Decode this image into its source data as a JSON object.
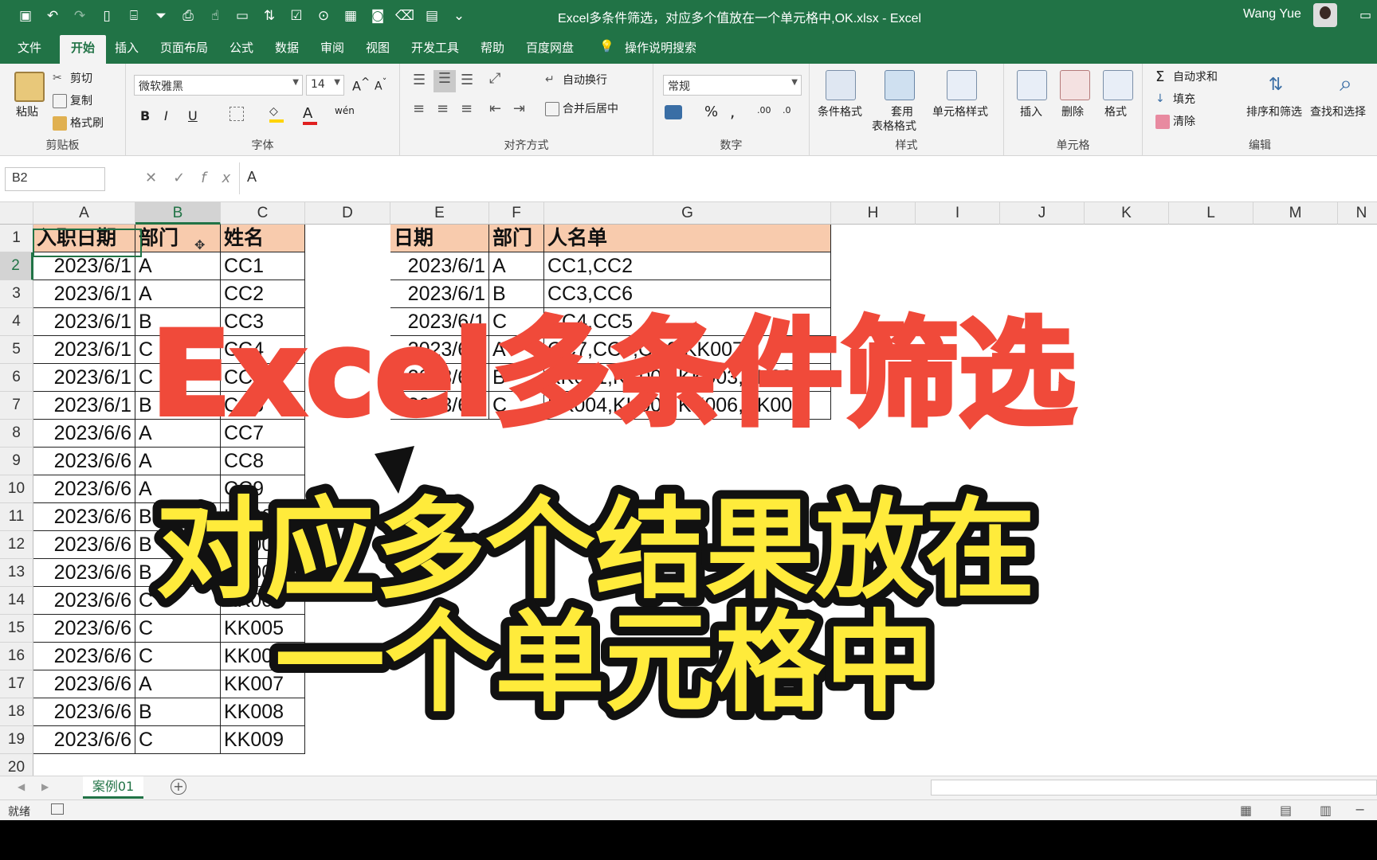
{
  "window": {
    "title": "Excel多条件筛选，对应多个值放在一个单元格中,OK.xlsx  -  Excel",
    "user": "Wang Yue"
  },
  "ribbon_tabs": [
    "文件",
    "开始",
    "插入",
    "页面布局",
    "公式",
    "数据",
    "审阅",
    "视图",
    "开发工具",
    "帮助",
    "百度网盘",
    "操作说明搜索"
  ],
  "active_tab": "开始",
  "ribbon": {
    "clipboard": {
      "paste": "粘贴",
      "cut": "剪切",
      "copy": "复制",
      "format_painter": "格式刷",
      "label": "剪贴板"
    },
    "font": {
      "name": "微软雅黑",
      "size": "14",
      "bold": "B",
      "italic": "I",
      "underline": "U",
      "wen": "wén",
      "label": "字体"
    },
    "align": {
      "wrap": "自动换行",
      "merge": "合并后居中",
      "label": "对齐方式"
    },
    "number": {
      "format": "常规",
      "percent": "%",
      "comma": ",",
      "label": "数字"
    },
    "styles": {
      "cond": "条件格式",
      "table1": "套用",
      "table2": "表格格式",
      "cell": "单元格样式",
      "label": "样式"
    },
    "cells": {
      "insert": "插入",
      "delete": "删除",
      "format": "格式",
      "label": "单元格"
    },
    "edit": {
      "autosum": "自动求和",
      "fill": "填充",
      "clear": "清除",
      "sort": "排序和筛选",
      "find": "查找和选择",
      "label": "编辑"
    }
  },
  "formula_bar": {
    "name_box": "B2",
    "fx": "fx",
    "value": "A"
  },
  "sheet": {
    "columns": [
      "A",
      "B",
      "C",
      "D",
      "E",
      "F",
      "G",
      "H",
      "I",
      "J",
      "K",
      "L",
      "M",
      "N"
    ],
    "selected_cell": "B2",
    "row_numbers": [
      "1",
      "2",
      "3",
      "4",
      "5",
      "6",
      "7",
      "8",
      "9",
      "10",
      "11",
      "12",
      "13",
      "14",
      "15",
      "16",
      "17",
      "18",
      "19",
      "20"
    ],
    "left_headers": [
      "入职日期",
      "部门",
      "姓名"
    ],
    "left_rows": [
      [
        "2023/6/1",
        "A",
        "CC1"
      ],
      [
        "2023/6/1",
        "A",
        "CC2"
      ],
      [
        "2023/6/1",
        "B",
        "CC3"
      ],
      [
        "2023/6/1",
        "C",
        "CC4"
      ],
      [
        "2023/6/1",
        "C",
        "CC5"
      ],
      [
        "2023/6/1",
        "B",
        "CC6"
      ],
      [
        "2023/6/6",
        "A",
        "CC7"
      ],
      [
        "2023/6/6",
        "A",
        "CC8"
      ],
      [
        "2023/6/6",
        "A",
        "CC9"
      ],
      [
        "2023/6/6",
        "B",
        "KK001"
      ],
      [
        "2023/6/6",
        "B",
        "KK002"
      ],
      [
        "2023/6/6",
        "B",
        "KK003"
      ],
      [
        "2023/6/6",
        "C",
        "KK004"
      ],
      [
        "2023/6/6",
        "C",
        "KK005"
      ],
      [
        "2023/6/6",
        "C",
        "KK006"
      ],
      [
        "2023/6/6",
        "A",
        "KK007"
      ],
      [
        "2023/6/6",
        "B",
        "KK008"
      ],
      [
        "2023/6/6",
        "C",
        "KK009"
      ]
    ],
    "right_headers": [
      "日期",
      "部门",
      "人名单"
    ],
    "right_rows": [
      [
        "2023/6/1",
        "A",
        "CC1,CC2"
      ],
      [
        "2023/6/1",
        "B",
        "CC3,CC6"
      ],
      [
        "2023/6/1",
        "C",
        "CC4,CC5"
      ],
      [
        "2023/6/6",
        "A",
        "CC7,CC8,CC9,KK007"
      ],
      [
        "2023/6/6",
        "B",
        "KK001,KK002,KK003,KK008"
      ],
      [
        "2023/6/6",
        "C",
        "KK004,KK005,KK006,KK009"
      ]
    ]
  },
  "sheet_tabs": [
    "案例01"
  ],
  "status": {
    "ready": "就绪"
  },
  "overlay": {
    "line1": "Excel多条件筛选",
    "line2": "对应多个结果放在",
    "line3": "一个单元格中",
    "red": "#f04a3a",
    "yellow": "#ffeb3b"
  }
}
